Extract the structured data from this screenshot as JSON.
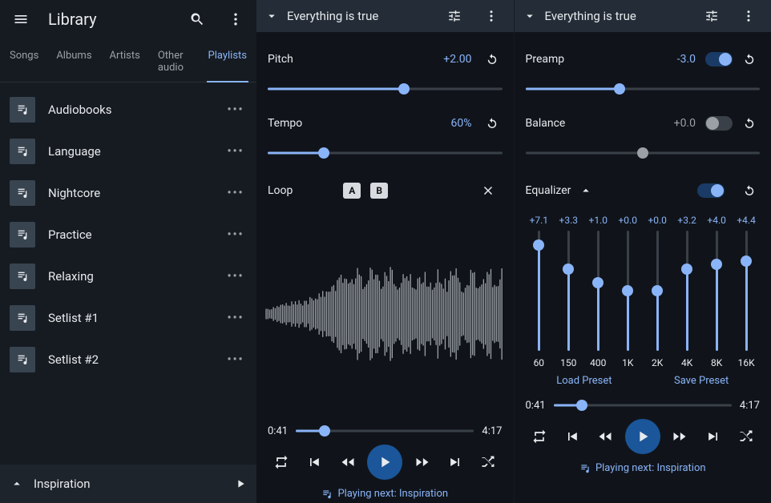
{
  "sidebar": {
    "title": "Library",
    "tabs": [
      "Songs",
      "Albums",
      "Artists",
      "Other audio",
      "Playlists"
    ],
    "active_tab": 4,
    "playlists": [
      "Audiobooks",
      "Language",
      "Nightcore",
      "Practice",
      "Relaxing",
      "Setlist #1",
      "Setlist #2"
    ],
    "now_playing": "Inspiration"
  },
  "panelA": {
    "title": "Everything is true",
    "pitch": {
      "label": "Pitch",
      "value": "+2.00",
      "percent": 58
    },
    "tempo": {
      "label": "Tempo",
      "value": "60%",
      "percent": 24
    },
    "loop": {
      "label": "Loop",
      "a": "A",
      "b": "B"
    },
    "position": "0:41",
    "duration": "4:17",
    "seek_percent": 16,
    "next": "Playing next: Inspiration"
  },
  "panelB": {
    "title": "Everything is true",
    "preamp": {
      "label": "Preamp",
      "value": "-3.0",
      "on": true,
      "percent": 40
    },
    "balance": {
      "label": "Balance",
      "value": "+0.0",
      "on": false,
      "percent": 50
    },
    "equalizer": {
      "label": "Equalizer",
      "on": true,
      "gains": [
        "+7.1",
        "+3.3",
        "+1.0",
        "+0.0",
        "+0.0",
        "+3.2",
        "+4.0",
        "+4.4"
      ],
      "band_percent": [
        88,
        68,
        57,
        50,
        50,
        68,
        72,
        75
      ],
      "freqs": [
        "60",
        "150",
        "400",
        "1K",
        "2K",
        "4K",
        "8K",
        "16K"
      ],
      "load": "Load Preset",
      "save": "Save Preset"
    },
    "position": "0:41",
    "duration": "4:17",
    "seek_percent": 16,
    "next": "Playing next: Inspiration"
  }
}
